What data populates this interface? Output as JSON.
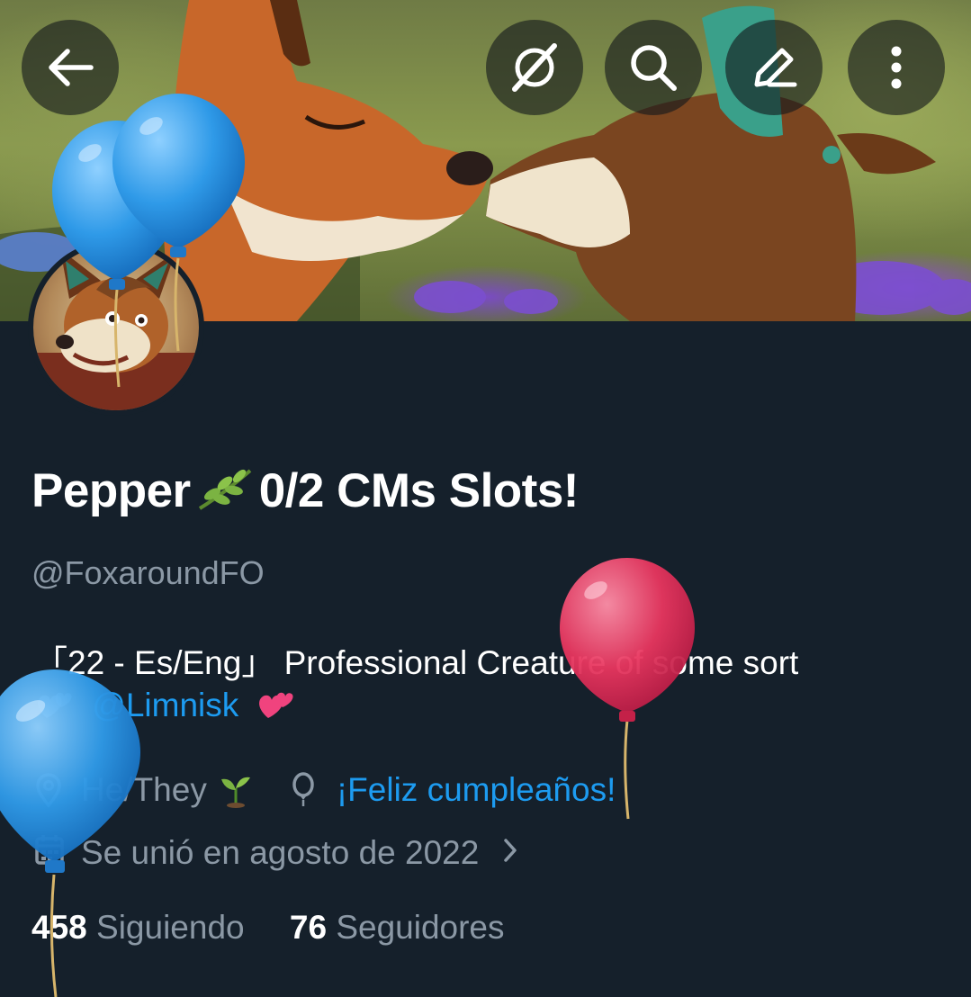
{
  "header": {
    "back_icon": "arrow-left-icon",
    "grok_icon": "grok-icon",
    "search_icon": "search-icon",
    "edit_icon": "pencil-icon",
    "more_icon": "more-vertical-icon"
  },
  "profile": {
    "name_part1": "Pepper",
    "name_part2": "0/2 CMs Slots!",
    "handle": "@FoxaroundFO",
    "bio_line1": "「22 - Es/Eng」 Professional Creature of some sort",
    "bio_mention": "@Limnisk",
    "pronouns": "He/They",
    "birthday_text": "¡Feliz cumpleaños!",
    "joined": "Se unió en agosto de 2022",
    "following_count": "458",
    "following_label": "Siguiendo",
    "followers_count": "76",
    "followers_label": "Seguidores"
  },
  "colors": {
    "background": "#15202b",
    "accent": "#1d9bf0",
    "muted": "#8b98a5",
    "text": "#ffffff"
  }
}
